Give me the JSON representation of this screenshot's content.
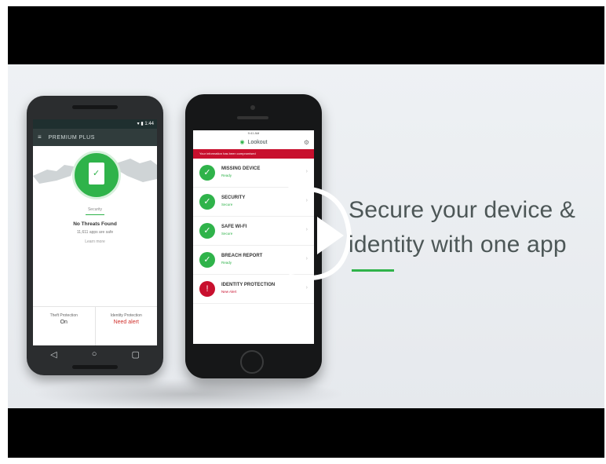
{
  "headline": {
    "line1": "Secure your device &",
    "line2": "identity with one app"
  },
  "colors": {
    "accent": "#2fb34a",
    "danger": "#c8102e",
    "text": "#4d5757"
  },
  "android": {
    "status_bar": "▾ ▮ 1:44",
    "appbar_title": "PREMIUM PLUS",
    "security_label": "Security",
    "status_main": "No Threats Found",
    "status_sub": "11,611 apps are safe",
    "link_text": "Learn more",
    "bottom_cells": [
      {
        "label": "Theft Protection",
        "value": "On"
      },
      {
        "label": "Identity Protection",
        "value": "Need alert"
      }
    ]
  },
  "iphone": {
    "status_bar": "9:41 AM",
    "app_title": "Lookout",
    "alert_banner": "Your information has been compromised",
    "rows": [
      {
        "title": "MISSING DEVICE",
        "status": "Ready",
        "state": "ok"
      },
      {
        "title": "SECURITY",
        "status": "Secure",
        "state": "ok"
      },
      {
        "title": "SAFE WI-FI",
        "status": "Secure",
        "state": "ok"
      },
      {
        "title": "BREACH REPORT",
        "status": "Ready",
        "state": "ok"
      },
      {
        "title": "IDENTITY PROTECTION",
        "status": "New Alert",
        "state": "alert"
      }
    ]
  }
}
